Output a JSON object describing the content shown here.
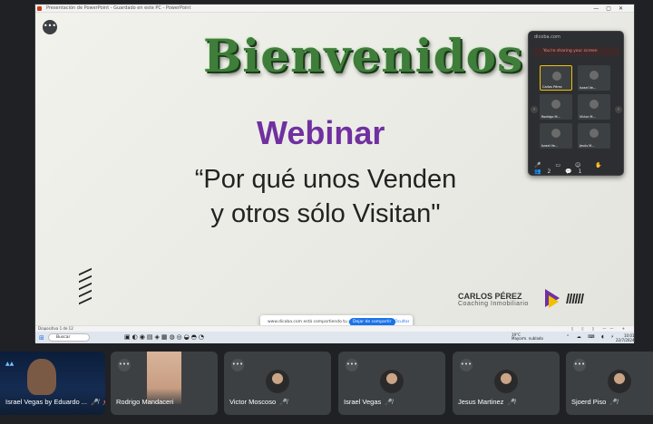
{
  "window": {
    "title": "Presentación de PowerPoint - Guardado en este PC - PowerPoint",
    "more_label": "•••"
  },
  "slide": {
    "heading": "Bienvenidos",
    "title": "Webinar",
    "subtitle_line1": "“Por qué unos Venden",
    "subtitle_line2": "y otros sólo Visitan\"",
    "brand_name": "CARLOS PÉREZ",
    "brand_tagline": "Coaching Inmobiliario",
    "brand_slashes": "//////",
    "colors": {
      "heading": "#3f7d3a",
      "title": "#7030a0"
    }
  },
  "share_notice": {
    "text": "www.dicoba.com está compartiendo tu pantalla",
    "stop_label": "Dejar de compartir",
    "hide_label": "Ocultar"
  },
  "status_bar": {
    "left": "Diapositiva 1 de 12",
    "right": "▯ ▯ ▯ —— +"
  },
  "taskbar": {
    "search_placeholder": "Buscar",
    "weather_temp": "19°C",
    "weather_desc": "Mayorm. nublado",
    "time": "10:01",
    "date": "22/7/2024"
  },
  "meet_panel": {
    "header": "dicoba.com",
    "warning": "You're sharing your screen",
    "tiles": [
      {
        "name": "Carlos Pérez"
      },
      {
        "name": "Israel Ve..."
      },
      {
        "name": "Rodrigo M..."
      },
      {
        "name": "Víctor M..."
      },
      {
        "name": "Israel Ve..."
      },
      {
        "name": "Jesús M..."
      }
    ],
    "controls": "🎤 ▭ ☺ ✋ 👥2 💬1"
  },
  "participants": [
    {
      "name": "Israel Vegas by Eduardo ...",
      "type": "video"
    },
    {
      "name": "Rodrigo Mandaceri",
      "type": "video"
    },
    {
      "name": "Victor Moscoso",
      "type": "avatar"
    },
    {
      "name": "Israel Vegas",
      "type": "avatar"
    },
    {
      "name": "Jesus Martinez",
      "type": "avatar"
    },
    {
      "name": "Sjoerd Piso",
      "type": "avatar"
    }
  ]
}
